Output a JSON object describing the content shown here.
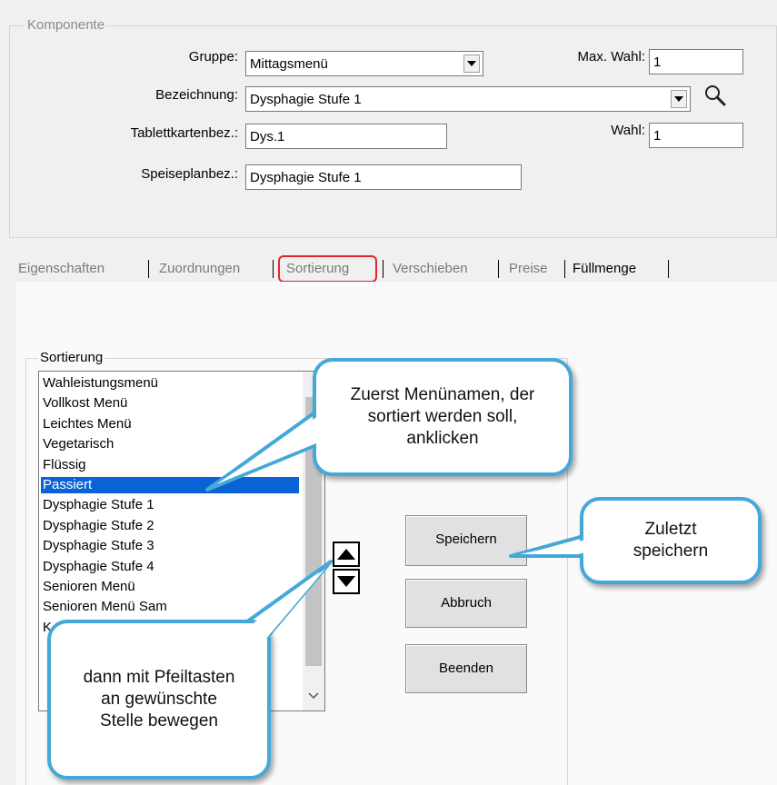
{
  "komponente": {
    "title": "Komponente",
    "gruppe_label": "Gruppe:",
    "gruppe_value": "Mittagsmenü",
    "max_wahl_label": "Max. Wahl:",
    "max_wahl_value": "1",
    "bezeichnung_label": "Bezeichnung:",
    "bezeichnung_value": "Dysphagie Stufe 1",
    "tablettkarten_label": "Tablettkartenbez.:",
    "tablettkarten_value": "Dys.1",
    "wahl_label": "Wahl:",
    "wahl_value": "1",
    "speiseplan_label": "Speiseplanbez.:",
    "speiseplan_value": "Dysphagie Stufe 1"
  },
  "tabs": [
    {
      "label": "Eigenschaften"
    },
    {
      "label": "Zuordnungen"
    },
    {
      "label": "Sortierung"
    },
    {
      "label": "Verschieben"
    },
    {
      "label": "Preise"
    },
    {
      "label": "Füllmenge"
    }
  ],
  "sortierung": {
    "title": "Sortierung",
    "items": [
      "Wahleistungsmenü",
      "Vollkost Menü",
      "Leichtes Menü",
      "Vegetarisch",
      "Flüssig",
      "Passiert",
      "Dysphagie Stufe 1",
      "Dysphagie Stufe 2",
      "Dysphagie Stufe 3",
      "Dysphagie Stufe 4",
      "Senioren Menü",
      "Senioren Menü Sam",
      "K"
    ],
    "selected_item": "Passiert"
  },
  "buttons": {
    "speichern": "Speichern",
    "abbruch": "Abbruch",
    "beenden": "Beenden"
  },
  "callouts": {
    "first": "Zuerst Menünamen, der sortiert werden soll, anklicken",
    "second": "dann mit Pfeiltasten an gewünschte Stelle bewegen",
    "third": "Zuletzt speichern"
  },
  "colors": {
    "callout_border": "#44a8d8",
    "selection": "#0a63d6",
    "tab_highlight": "#e0262b"
  },
  "icons": {
    "search": "magnifier-icon",
    "move_up": "arrow-up-icon",
    "move_down": "arrow-down-icon"
  }
}
